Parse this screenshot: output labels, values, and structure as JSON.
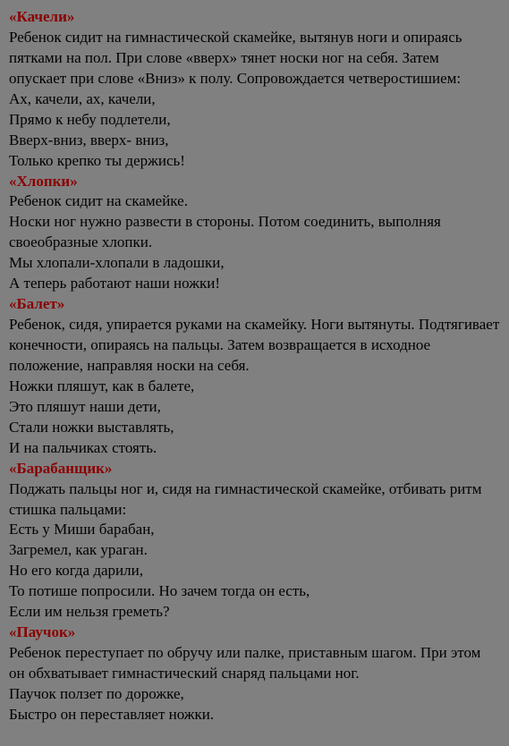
{
  "sections": [
    {
      "title": "«Качели»",
      "lines": [
        "Ребенок сидит на гимнастической скамейке, вытянув ноги и опираясь пятками на пол. При слове «вверх» тянет носки ног на себя. Затем опускает при слове «Вниз» к полу. Сопровождается четверостишием:",
        "Ах, качели, ах, качели,",
        "Прямо к небу подлетели,",
        "Вверх-вниз, вверх- вниз,",
        "Только крепко ты держись!"
      ]
    },
    {
      "title": "«Хлопки»",
      "lines": [
        "Ребенок сидит на скамейке.",
        "Носки ног нужно развести в стороны. Потом соединить, выполняя своеобразные хлопки.",
        "Мы хлопали-хлопали в ладошки,",
        "А теперь работают наши ножки!"
      ]
    },
    {
      "title": "«Балет»",
      "lines": [
        "Ребенок, сидя, упирается руками на скамейку. Ноги вытянуты. Подтягивает конечности, опираясь на пальцы. Затем возвращается в исходное положение, направляя носки на себя.",
        "Ножки пляшут, как в балете,",
        "Это пляшут наши дети,",
        "Стали ножки выставлять,",
        "И на пальчиках стоять."
      ]
    },
    {
      "title": "«Барабанщик»",
      "lines": [
        "Поджать пальцы ног и, сидя на гимнастической скамейке, отбивать ритм стишка пальцами:",
        "Есть у Миши барабан,",
        "Загремел, как ураган.",
        "Но его когда дарили,",
        "То потише попросили. Но зачем тогда он есть,",
        "Если им нельзя греметь?"
      ]
    },
    {
      "title": "«Паучок»",
      "lines": [
        "Ребенок переступает по обручу или палке, приставным шагом. При этом он обхватывает гимнастический снаряд пальцами ног.",
        "Паучок ползет по дорожке,",
        "Быстро он переставляет ножки."
      ]
    }
  ]
}
